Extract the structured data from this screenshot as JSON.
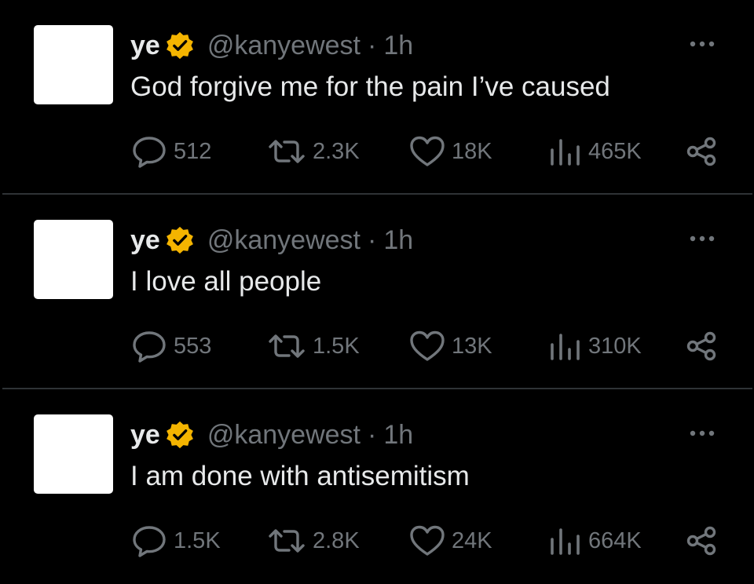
{
  "colors": {
    "background": "#000000",
    "text_primary": "#e7e9ea",
    "text_secondary": "#71767b",
    "divider": "#2f3336",
    "verified_badge": "#f4b400"
  },
  "tweets": [
    {
      "display_name": "ye",
      "handle": "@kanyewest",
      "separator": "·",
      "time": "1h",
      "text": "God forgive me for the pain I’ve caused",
      "replies": "512",
      "retweets": "2.3K",
      "likes": "18K",
      "views": "465K"
    },
    {
      "display_name": "ye",
      "handle": "@kanyewest",
      "separator": "·",
      "time": "1h",
      "text": "I love all people",
      "replies": "553",
      "retweets": "1.5K",
      "likes": "13K",
      "views": "310K"
    },
    {
      "display_name": "ye",
      "handle": "@kanyewest",
      "separator": "·",
      "time": "1h",
      "text": "I am done with antisemitism",
      "replies": "1.5K",
      "retweets": "2.8K",
      "likes": "24K",
      "views": "664K"
    }
  ],
  "icons": {
    "verified": "verified-badge-icon",
    "more": "more-options-icon",
    "reply": "reply-icon",
    "retweet": "retweet-icon",
    "like": "like-icon",
    "views": "views-icon",
    "share": "share-icon"
  }
}
